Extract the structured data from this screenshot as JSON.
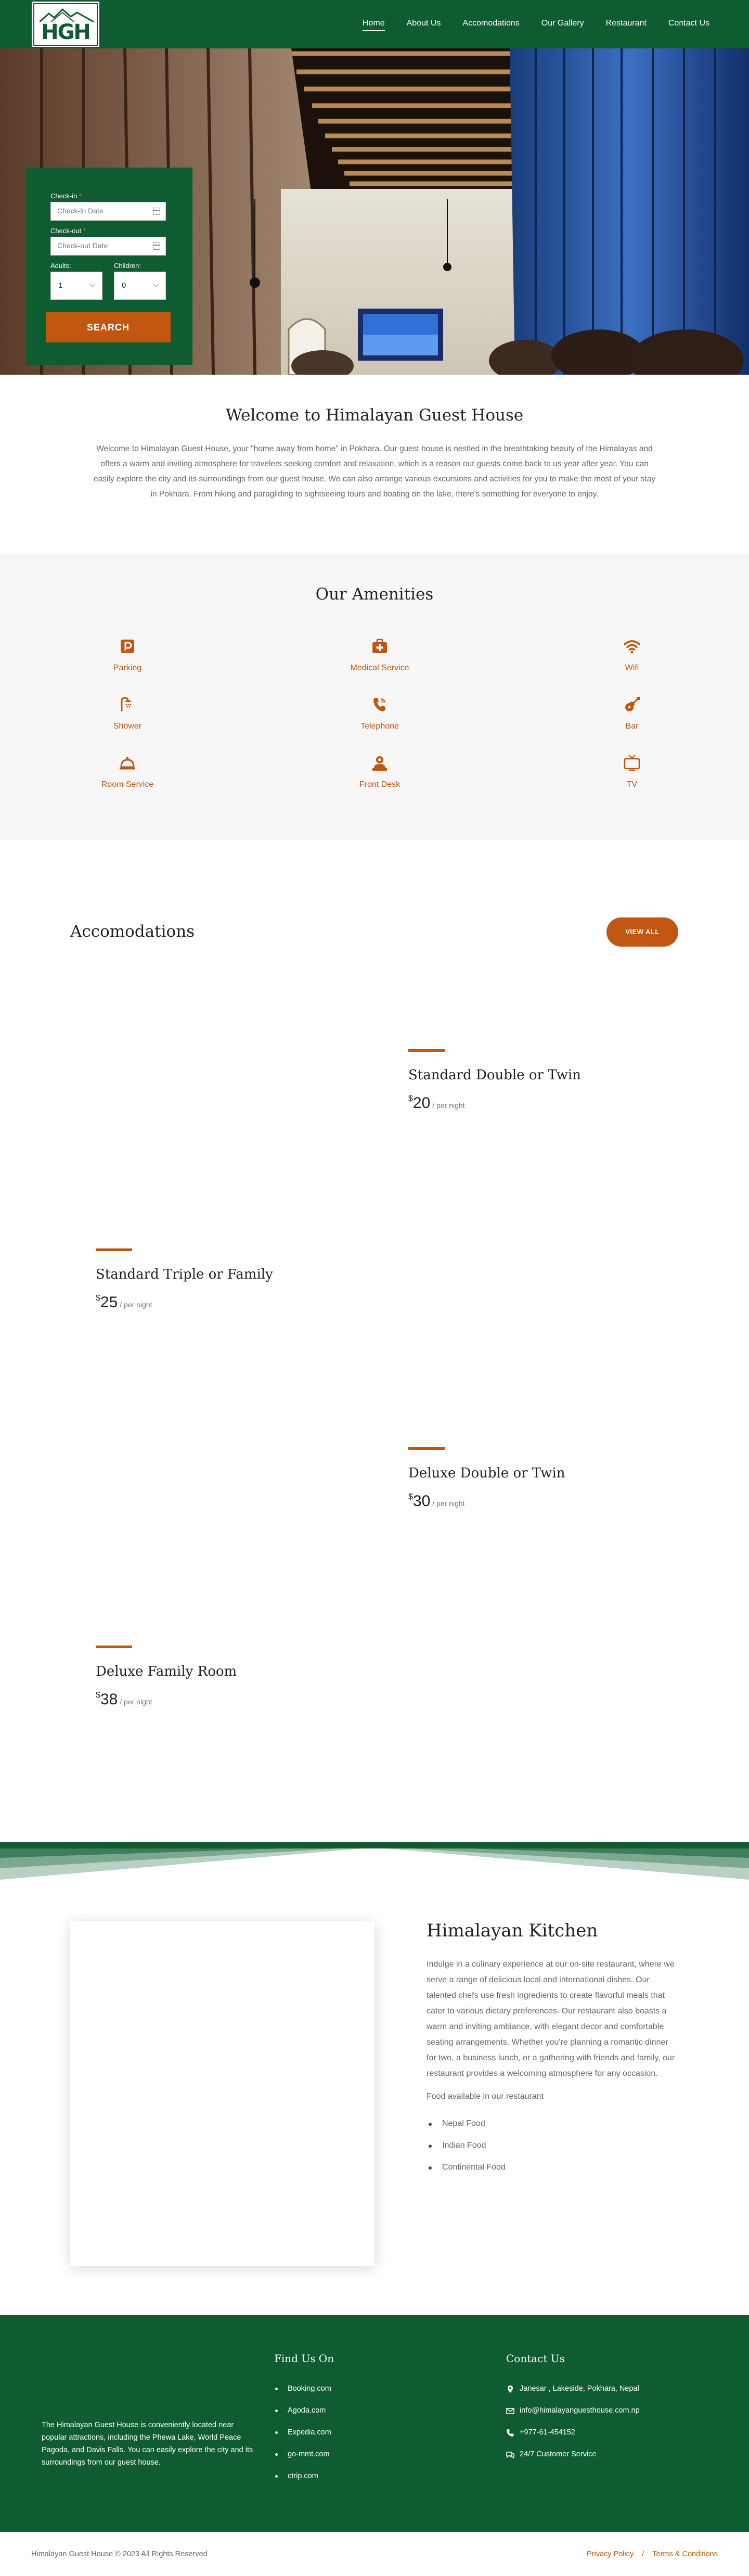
{
  "nav": {
    "logo_text": "HGH",
    "links": [
      "Home",
      "About Us",
      "Accomodations",
      "Our Gallery",
      "Restaurant",
      "Contact Us"
    ],
    "active": "Home"
  },
  "booking": {
    "checkin_label": "Check-in",
    "checkin_placeholder": "Check-in Date",
    "checkout_label": "Check-out",
    "checkout_placeholder": "Check-out Date",
    "required_mark": "*",
    "adults_label": "Adults:",
    "adults_value": "1",
    "children_label": "Children:",
    "children_value": "0",
    "search_label": "SEARCH"
  },
  "welcome": {
    "title": "Welcome to Himalayan Guest House",
    "body": "Welcome to Himalayan Guest House, your \"home away from home\" in Pokhara. Our guest house is nestled in the breathtaking beauty of the Himalayas and offers a warm and inviting atmosphere for travelers seeking comfort and relaxation, which is a reason our guests come back to us year after year. You can easily explore the city and its surroundings from our guest house. We can also arrange various excursions and activities for you to make the most of your stay in Pokhara. From hiking and paragliding to sightseeing tours and boating on the lake, there's something for everyone to enjoy."
  },
  "amenities": {
    "title": "Our Amenities",
    "items": [
      {
        "label": "Parking",
        "icon": "parking-icon"
      },
      {
        "label": "Medical Service",
        "icon": "medical-kit-icon"
      },
      {
        "label": "Wifi",
        "icon": "wifi-icon"
      },
      {
        "label": "Shower",
        "icon": "shower-icon"
      },
      {
        "label": "Telephone",
        "icon": "telephone-icon"
      },
      {
        "label": "Bar",
        "icon": "guitar-icon"
      },
      {
        "label": "Room Service",
        "icon": "room-service-bell-icon"
      },
      {
        "label": "Front Desk",
        "icon": "front-desk-person-icon"
      },
      {
        "label": "TV",
        "icon": "tv-icon"
      }
    ]
  },
  "accomodations": {
    "title": "Accomodations",
    "view_all": "VIEW ALL",
    "currency": "$",
    "per_night": "/ per night",
    "rooms": [
      {
        "name": "Standard Double or Twin",
        "price": "20"
      },
      {
        "name": "Standard Triple or Family",
        "price": "25"
      },
      {
        "name": "Deluxe Double or Twin",
        "price": "30"
      },
      {
        "name": "Deluxe Family Room",
        "price": "38"
      }
    ]
  },
  "kitchen": {
    "title": "Himalayan Kitchen",
    "body": "Indulge in a culinary experience at our on-site restaurant, where we serve a range of delicious local and international dishes. Our talented chefs use fresh ingredients to create flavorful meals that cater to various dietary preferences. Our restaurant also boasts a warm and inviting ambiance, with elegant decor and comfortable seating arrangements. Whether you're planning a romantic dinner for two, a business lunch, or a gathering with friends and family, our restaurant provides a welcoming atmosphere for any occasion.",
    "food_heading": "Food available in our restaurant",
    "foods": [
      "Nepal Food",
      "Indian Food",
      "Continental Food"
    ]
  },
  "footer": {
    "about": "The Himalayan Guest House is conveniently located near popular attractions, including the Phewa Lake, World Peace Pagoda, and Davis Falls. You can easily explore the city and its surroundings from our guest house.",
    "find_us_title": "Find Us On",
    "find_us": [
      "Booking.com",
      "Agoda.com",
      "Expedia.com",
      "go-mmt.com",
      "ctrip.com"
    ],
    "contact_title": "Contact Us",
    "contacts": [
      {
        "text": "Janesar , Lakeside, Pokhara, Nepal",
        "icon": "location-pin-icon"
      },
      {
        "text": "info@himalayanguesthouse.com.np",
        "icon": "envelope-icon"
      },
      {
        "text": "+977-61-454152",
        "icon": "phone-icon"
      },
      {
        "text": "24/7 Customer Service",
        "icon": "chat-icon"
      }
    ],
    "copyright": "Himalayan Guest House © 2023 All Rights Reserved",
    "privacy": "Privacy Policy",
    "separator": "/",
    "terms": "Terms & Conditions"
  },
  "colors": {
    "brand_green": "#0f5c33",
    "accent_orange": "#c0560f"
  }
}
